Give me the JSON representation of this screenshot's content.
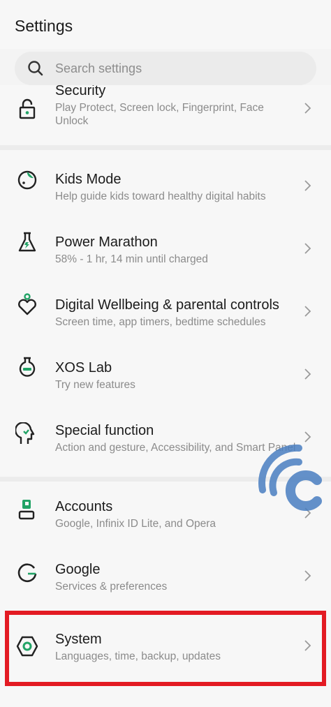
{
  "header": {
    "title": "Settings"
  },
  "search": {
    "placeholder": "Search settings"
  },
  "items": [
    {
      "title": "Security",
      "subtitle": "Play Protect, Screen lock, Fingerprint, Face Unlock",
      "icon": "lock-icon"
    },
    {
      "title": "Kids Mode",
      "subtitle": "Help guide kids toward healthy digital habits",
      "icon": "kids-mode-icon"
    },
    {
      "title": "Power Marathon",
      "subtitle": "58% - 1 hr, 14 min until charged",
      "icon": "flask-icon"
    },
    {
      "title": "Digital Wellbeing & parental controls",
      "subtitle": "Screen time, app timers, bedtime schedules",
      "icon": "wellbeing-heart-icon"
    },
    {
      "title": "XOS Lab",
      "subtitle": "Try new features",
      "icon": "lab-flask-icon"
    },
    {
      "title": "Special function",
      "subtitle": "Action and gesture, Accessibility, and Smart Panel",
      "icon": "head-profile-icon"
    },
    {
      "title": "Accounts",
      "subtitle": "Google, Infinix ID Lite, and Opera",
      "icon": "account-icon"
    },
    {
      "title": "Google",
      "subtitle": "Services & preferences",
      "icon": "google-icon"
    },
    {
      "title": "System",
      "subtitle": "Languages, time, backup, updates",
      "icon": "system-hexagon-icon"
    }
  ],
  "colors": {
    "accent": "#21a366",
    "highlight": "#e31b23",
    "watermark": "#4a7fc1"
  }
}
